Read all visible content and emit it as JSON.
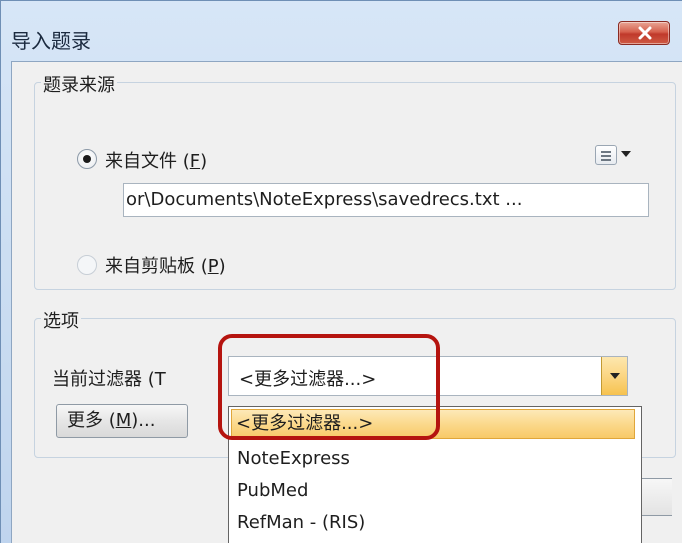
{
  "window": {
    "title": "导入题录",
    "close_icon": "close-icon"
  },
  "source_group": {
    "legend": "题录来源",
    "from_file": {
      "label_text": "来自文件 (",
      "label_key": "F",
      "label_close": ")",
      "checked": true
    },
    "file_path": "or\\Documents\\NoteExpress\\savedrecs.txt  ...",
    "from_clipboard": {
      "label_text": "来自剪贴板 (",
      "label_key": "P",
      "label_close": ")",
      "checked": false
    },
    "menu_icon": "list-menu-icon"
  },
  "options_group": {
    "legend": "选项",
    "filter_label": "当前过滤器 (T",
    "filter_value": "<更多过滤器...>",
    "more_button": {
      "text": "更多 (",
      "key": "M",
      "close": ")..."
    }
  },
  "filter_dropdown": {
    "options": [
      "<更多过滤器...>",
      "NoteExpress",
      "PubMed",
      "RefMan - (RIS)"
    ],
    "selected_index": 0
  },
  "colors": {
    "highlight": "#b5140f",
    "selection": "#fbd98c",
    "title_bar": "#d7e6f7"
  }
}
